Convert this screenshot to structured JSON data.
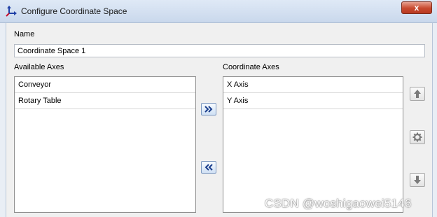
{
  "window": {
    "title": "Configure Coordinate Space",
    "close_label": "x"
  },
  "name_section": {
    "label": "Name",
    "value": "Coordinate Space 1"
  },
  "available": {
    "label": "Available Axes",
    "items": [
      "Conveyor",
      "Rotary Table"
    ]
  },
  "coordinate": {
    "label": "Coordinate Axes",
    "items": [
      "X Axis",
      "Y Axis"
    ]
  },
  "icons": {
    "add": "double-chevron-right-icon",
    "remove": "double-chevron-left-icon",
    "up": "arrow-up-icon",
    "settings": "gear-icon",
    "down": "arrow-down-icon"
  },
  "watermark": "CSDN @woshigaowei5146"
}
